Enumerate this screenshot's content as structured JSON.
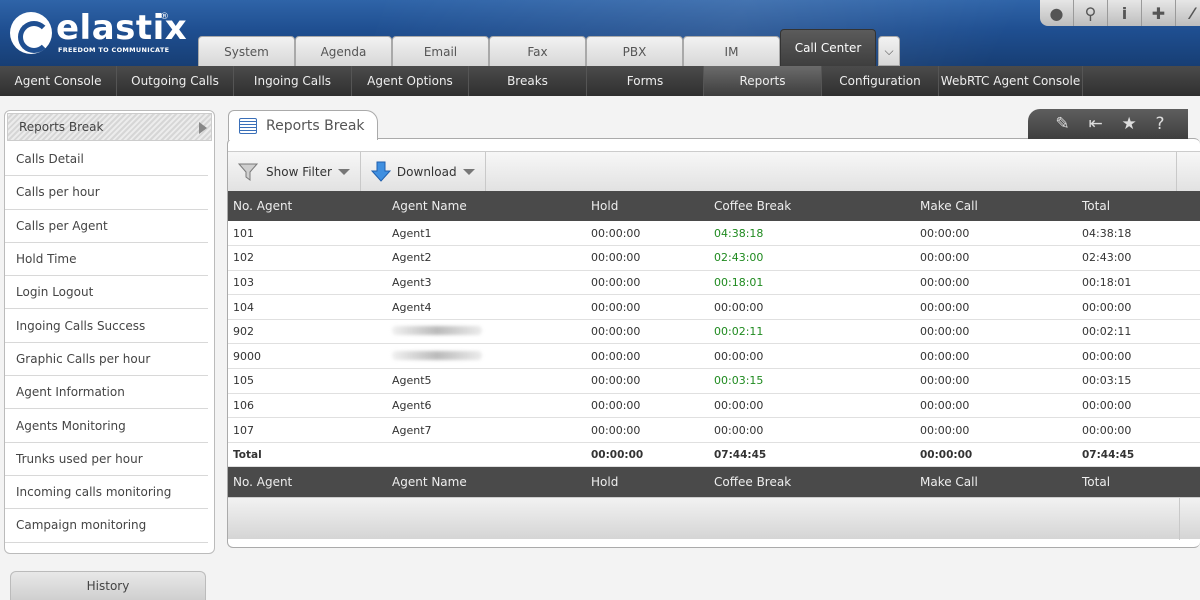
{
  "brand": {
    "name": "elastix",
    "registered": "®",
    "tagline": "FREEDOM TO COMMUNICATE"
  },
  "top_tools": [
    {
      "icon": "drop-icon",
      "glyph": "●"
    },
    {
      "icon": "search-icon",
      "glyph": "⚲"
    },
    {
      "icon": "info-icon",
      "glyph": "i"
    },
    {
      "icon": "puzzle-icon",
      "glyph": "✚"
    },
    {
      "icon": "user-icon",
      "glyph": "⁄"
    }
  ],
  "module_tabs": [
    "System",
    "Agenda",
    "Email",
    "Fax",
    "PBX",
    "IM",
    "Call Center"
  ],
  "module_active": "Call Center",
  "module_more_glyph": "⌵",
  "nav": [
    {
      "label": "Agent Console",
      "width": 117
    },
    {
      "label": "Outgoing Calls",
      "width": 117
    },
    {
      "label": "Ingoing Calls",
      "width": 118
    },
    {
      "label": "Agent Options",
      "width": 117
    },
    {
      "label": "Breaks",
      "width": 118
    },
    {
      "label": "Forms",
      "width": 117
    },
    {
      "label": "Reports",
      "width": 118
    },
    {
      "label": "Configuration",
      "width": 117
    },
    {
      "label": "WebRTC Agent Console",
      "width": 144
    }
  ],
  "nav_active": "Reports",
  "sidebar": [
    "Reports Break",
    "Calls Detail",
    "Calls per hour",
    "Calls per Agent",
    "Hold Time",
    "Login Logout",
    "Ingoing Calls Success",
    "Graphic Calls per hour",
    "Agent Information",
    "Agents Monitoring",
    "Trunks used per hour",
    "Incoming calls monitoring",
    "Campaign monitoring"
  ],
  "sidebar_active": "Reports Break",
  "history_label": "History",
  "panel": {
    "title": "Reports Break",
    "tools": [
      {
        "icon": "edit-icon",
        "glyph": "✎"
      },
      {
        "icon": "collapse-icon",
        "glyph": "⇤"
      },
      {
        "icon": "star-icon",
        "glyph": "★"
      },
      {
        "icon": "help-icon",
        "glyph": "?"
      }
    ],
    "show_filter": "Show Filter",
    "download": "Download"
  },
  "table": {
    "columns": [
      "No. Agent",
      "Agent Name",
      "Hold",
      "Coffee Break",
      "Make Call",
      "Total"
    ],
    "rows": [
      [
        "101",
        "Agent1",
        "00:00:00",
        "04:38:18",
        "00:00:00",
        "04:38:18"
      ],
      [
        "102",
        "Agent2",
        "00:00:00",
        "02:43:00",
        "00:00:00",
        "02:43:00"
      ],
      [
        "103",
        "Agent3",
        "00:00:00",
        "00:18:01",
        "00:00:00",
        "00:18:01"
      ],
      [
        "104",
        "Agent4",
        "00:00:00",
        "00:00:00",
        "00:00:00",
        "00:00:00"
      ],
      [
        "902",
        "",
        "00:00:00",
        "00:02:11",
        "00:00:00",
        "00:02:11"
      ],
      [
        "9000",
        "",
        "00:00:00",
        "00:00:00",
        "00:00:00",
        "00:00:00"
      ],
      [
        "105",
        "Agent5",
        "00:00:00",
        "00:03:15",
        "00:00:00",
        "00:03:15"
      ],
      [
        "106",
        "Agent6",
        "00:00:00",
        "00:00:00",
        "00:00:00",
        "00:00:00"
      ],
      [
        "107",
        "Agent7",
        "00:00:00",
        "00:00:00",
        "00:00:00",
        "00:00:00"
      ]
    ],
    "total": [
      "Total",
      "",
      "00:00:00",
      "07:44:45",
      "00:00:00",
      "07:44:45"
    ],
    "accent_green": "#1f8a1f"
  }
}
